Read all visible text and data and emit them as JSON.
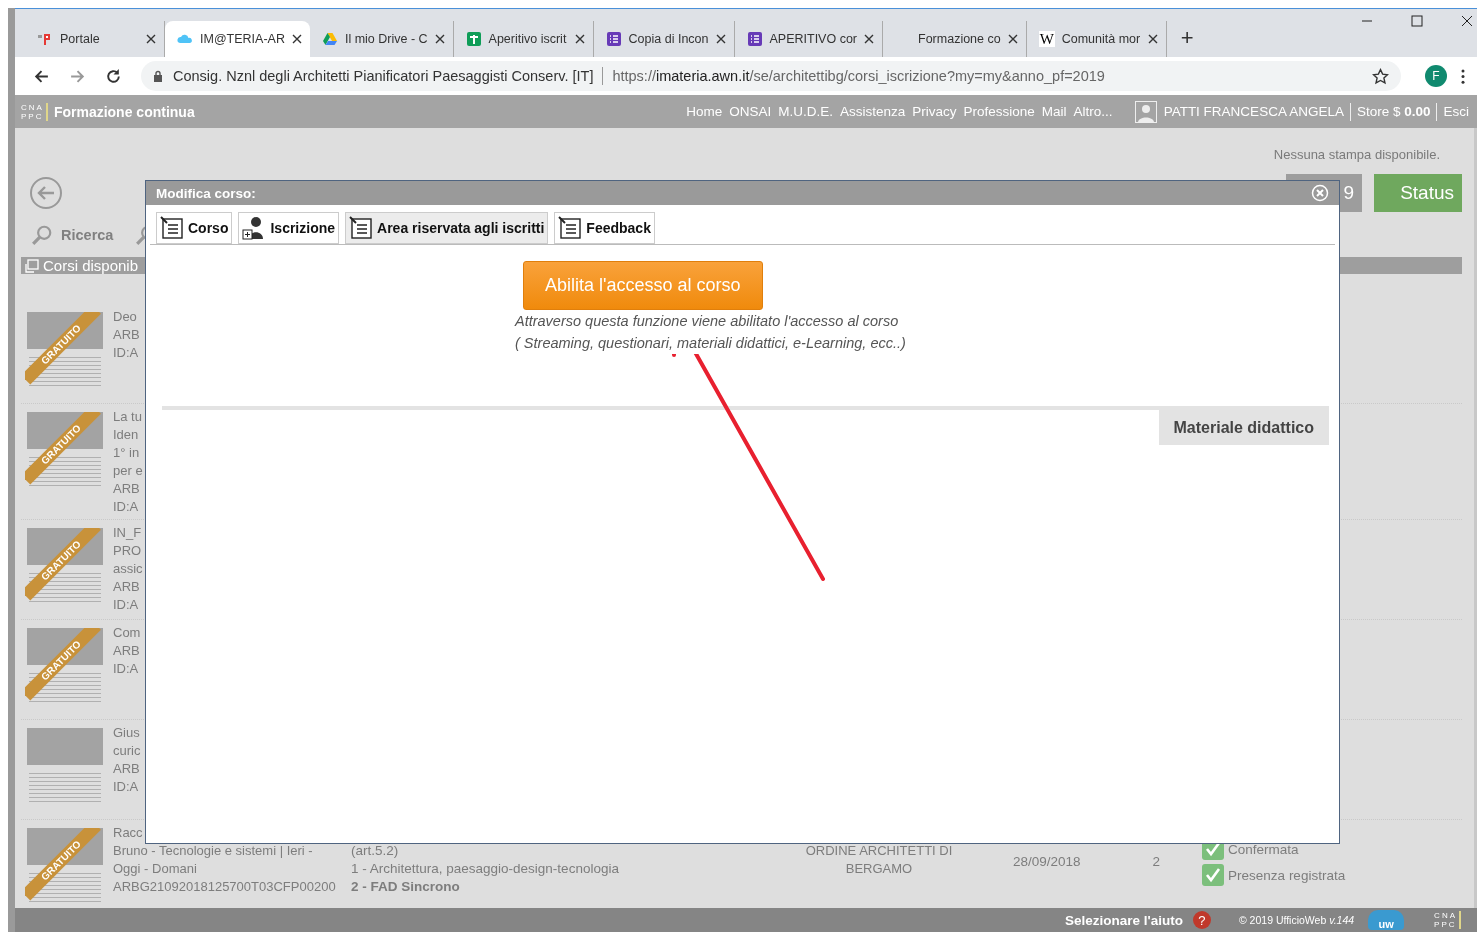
{
  "browser": {
    "tabs": [
      {
        "title": "Portale",
        "kind": "portal",
        "selected": false
      },
      {
        "title": "IM@TERIA-AR",
        "kind": "cloud",
        "selected": true
      },
      {
        "title": "Il mio Drive - C",
        "kind": "drive",
        "selected": false
      },
      {
        "title": "Aperitivo iscrit",
        "kind": "sheets",
        "selected": false
      },
      {
        "title": "Copia di Incon",
        "kind": "forms",
        "selected": false
      },
      {
        "title": "APERITIVO cor",
        "kind": "forms",
        "selected": false
      },
      {
        "title": "Formazione co",
        "kind": "blank",
        "selected": false
      },
      {
        "title": "Comunità mor",
        "kind": "letter",
        "letter": "W",
        "selected": false
      }
    ],
    "new_tab": "+",
    "site_name": "Consig. Nznl degli Architetti Pianificatori Paesaggisti Conserv. [IT]",
    "url": {
      "scheme": "https://",
      "host": "imateria.awn.it",
      "path": "/se/architettibg/corsi_iscrizione?my=my&anno_pf=2019"
    },
    "profile_initial": "F"
  },
  "header": {
    "logo_letters": [
      "CNA",
      "PPC"
    ],
    "title": "Formazione continua",
    "nav": [
      "Home",
      "ONSAI",
      "M.U.D.E.",
      "Assistenza",
      "Privacy",
      "Professione",
      "Mail",
      "Altro..."
    ],
    "user": "PATTI FRANCESCA ANGELA",
    "store": "Store $ **0.00**",
    "logout": "Esci"
  },
  "page": {
    "print_note": "Nessuna stampa disponibile.",
    "buttons": [
      {
        "label": "9",
        "kind": "plain"
      },
      {
        "label": "Status",
        "kind": "status"
      }
    ],
    "search_label": "Ricerca",
    "section_title": "Corsi disponib",
    "courses": [
      {
        "badge": "GRATUITO",
        "lines": [
          "Deo",
          "ARB",
          "ID:A"
        ]
      },
      {
        "badge": "GRATUITO",
        "lines": [
          "La tu",
          "Iden",
          "1° in",
          "per e",
          "ARB",
          "ID:A"
        ]
      },
      {
        "badge": "GRATUITO",
        "lines": [
          "IN_F",
          "PRO",
          "assic",
          "ARB",
          "ID:A"
        ]
      },
      {
        "badge": "GRATUITO",
        "lines": [
          "Com",
          "ARB",
          "ID:A"
        ]
      },
      {
        "lines": [
          "Gius",
          "curic",
          "ARB",
          "ID:A"
        ]
      },
      {
        "badge": "GRATUITO",
        "lines": [
          "Racc",
          "Bruno - Tecnologie e sistemi | Ieri -",
          "Oggi - Domani",
          "ARBG21092018125700T03CFP00200"
        ],
        "topics": [
          {
            "text": "(art.5.2)",
            "emphasis": false
          },
          {
            "text": "1 - Architettura, paesaggio-design-tecnologia",
            "emphasis": false
          },
          {
            "text": "2 - FAD Sincrono",
            "emphasis": true
          }
        ],
        "organizer": "ORDINE ARCHITETTI DI BERGAMO",
        "date": "28/09/2018",
        "credits": "2",
        "statuses": [
          {
            "label": "Confermata",
            "checked": true
          },
          {
            "label": "Presenza registrata",
            "checked": true
          }
        ]
      }
    ]
  },
  "modal": {
    "title": "Modifica corso:",
    "tabs": [
      {
        "label": "Corso",
        "kind": "document",
        "selected": false
      },
      {
        "label": "Iscrizione",
        "kind": "user",
        "selected": false
      },
      {
        "label": "Area riservata agli iscritti",
        "kind": "document",
        "selected": true
      },
      {
        "label": "Feedback",
        "kind": "document",
        "selected": false
      }
    ],
    "action_button": "Abilita l'accesso al corso",
    "description": [
      "Attraverso questa funzione viene abilitato l'accesso al corso",
      "( Streaming, questionari, materiali didattici, e-Learning, ecc..)"
    ],
    "section_tab": "Materiale didattico"
  },
  "footer": {
    "help": "Selezionare l'aiuto",
    "help_icon": "?",
    "copyright": "© 2019 UfficioWeb *v.144*",
    "cloud_logo_text": "uw",
    "logo_letters": [
      "CNA",
      "PPC"
    ]
  }
}
